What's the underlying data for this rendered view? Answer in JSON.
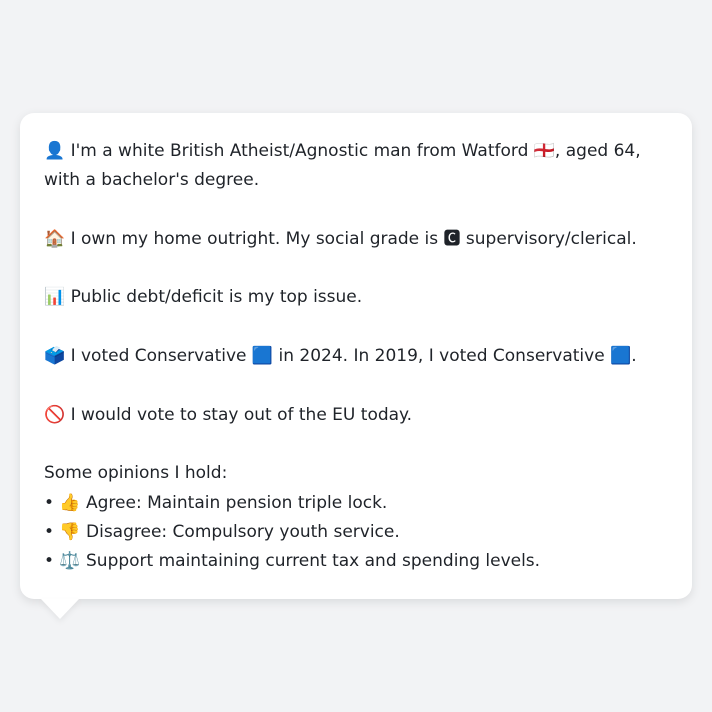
{
  "message": {
    "intro": "👤 I'm a white British Atheist/Agnostic man from Watford 🏴󠁧󠁢󠁥󠁮󠁧󠁿, aged 64, with a bachelor's degree.",
    "home": "🏠 I own my home outright. My social grade is 🅲 supervisory/clerical.",
    "issue": "📊 Public debt/deficit is my top issue.",
    "vote": "🗳️ I voted Conservative 🟦 in 2024. In 2019, I voted Conservative 🟦.",
    "eu": "🚫 I would vote to stay out of the EU today.",
    "opinions_heading": "Some opinions I hold:",
    "opinions": [
      "• 👍 Agree: Maintain pension triple lock.",
      "• 👎 Disagree: Compulsory youth service.",
      "• ⚖️ Support maintaining current tax and spending levels."
    ]
  },
  "colors": {
    "page_background": "#f2f3f5",
    "bubble_background": "#ffffff",
    "text": "#1f2329"
  }
}
